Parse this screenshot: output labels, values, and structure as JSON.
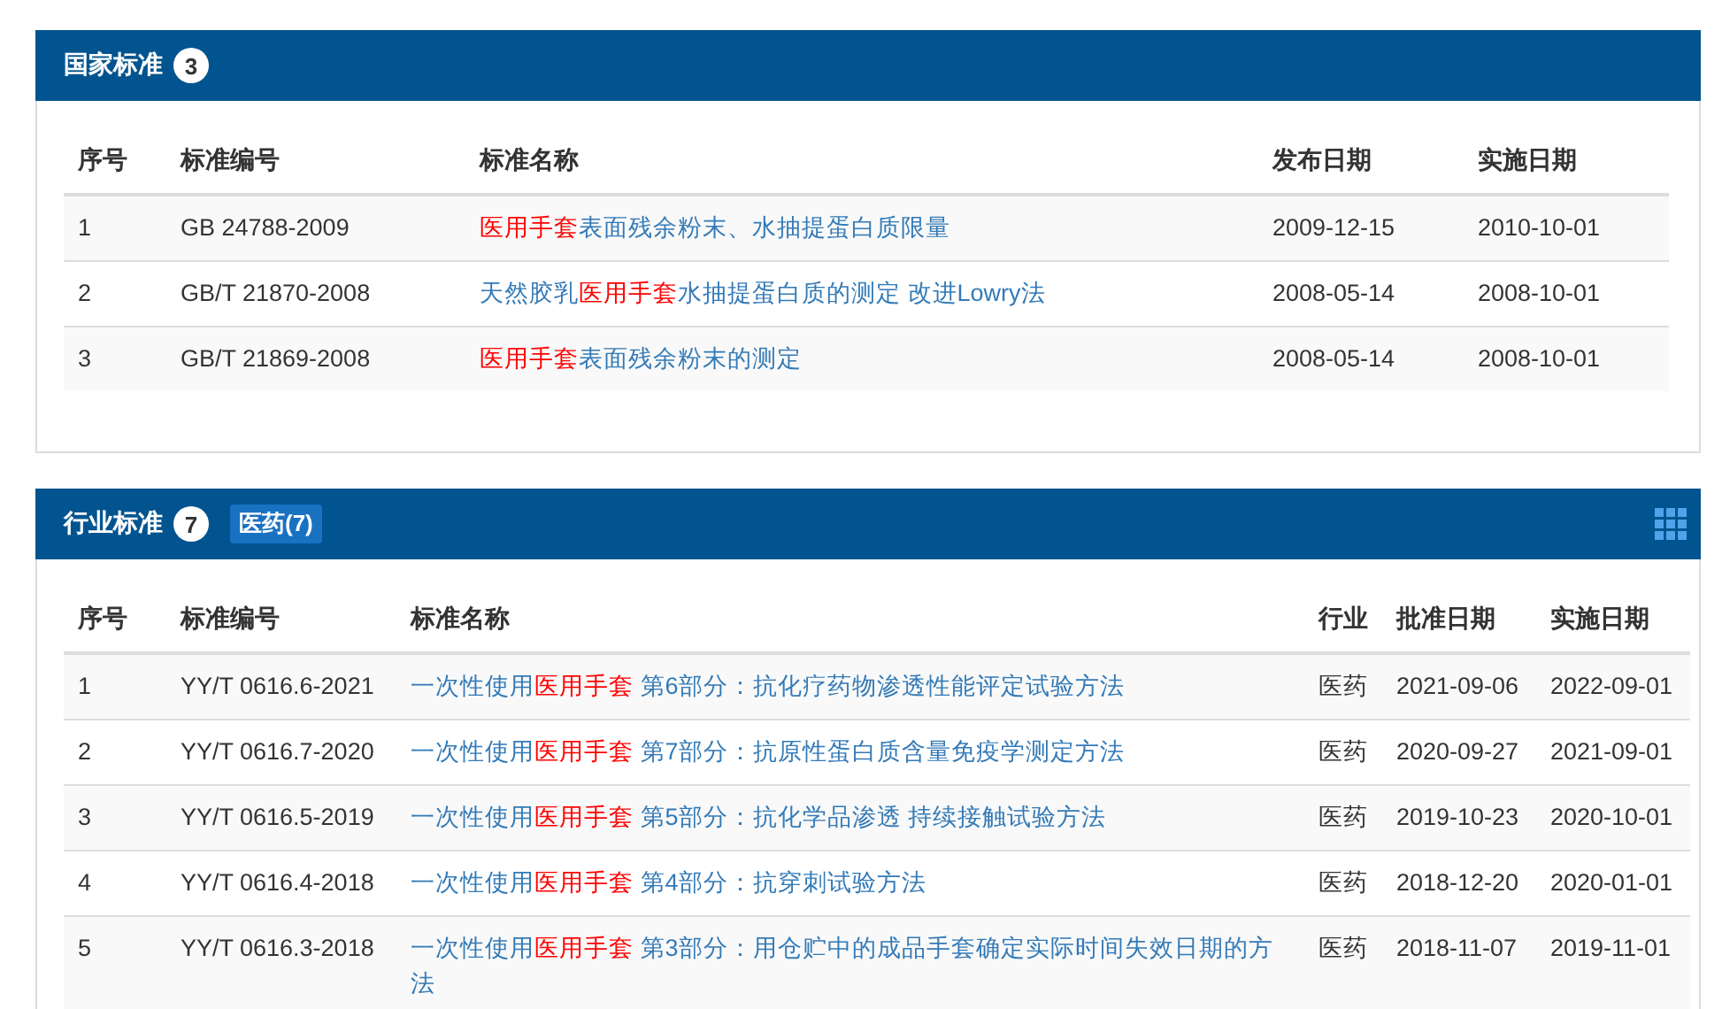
{
  "panels": [
    {
      "title": "国家标准",
      "count": "3",
      "grid_icon": false,
      "columns": [
        {
          "label": "序号",
          "kind": "index"
        },
        {
          "label": "标准编号",
          "kind": "code"
        },
        {
          "label": "标准名称",
          "kind": "name"
        },
        {
          "label": "发布日期",
          "kind": "date"
        },
        {
          "label": "实施日期",
          "kind": "date"
        }
      ],
      "rows": [
        {
          "cells": [
            "1",
            "GB 24788-2009",
            [
              {
                "text": "医用手套",
                "highlight": true
              },
              {
                "text": "表面残余粉末、水抽提蛋白质限量",
                "highlight": false
              }
            ],
            "2009-12-15",
            "2010-10-01"
          ]
        },
        {
          "cells": [
            "2",
            "GB/T 21870-2008",
            [
              {
                "text": "天然胶乳",
                "highlight": false
              },
              {
                "text": "医用手套",
                "highlight": true
              },
              {
                "text": "水抽提蛋白质的测定 改进Lowry法",
                "highlight": false
              }
            ],
            "2008-05-14",
            "2008-10-01"
          ]
        },
        {
          "cells": [
            "3",
            "GB/T 21869-2008",
            [
              {
                "text": "医用手套",
                "highlight": true
              },
              {
                "text": "表面残余粉末的测定",
                "highlight": false
              }
            ],
            "2008-05-14",
            "2008-10-01"
          ]
        }
      ]
    },
    {
      "title": "行业标准",
      "count": "7",
      "tags": [
        "医药(7)"
      ],
      "grid_icon": true,
      "columns": [
        {
          "label": "序号",
          "kind": "index"
        },
        {
          "label": "标准编号",
          "kind": "code2"
        },
        {
          "label": "标准名称",
          "kind": "name2"
        },
        {
          "label": "行业",
          "kind": "industry"
        },
        {
          "label": "批准日期",
          "kind": "date2"
        },
        {
          "label": "实施日期",
          "kind": "date2"
        }
      ],
      "rows": [
        {
          "cells": [
            "1",
            "YY/T 0616.6-2021",
            [
              {
                "text": "一次性使用",
                "highlight": false
              },
              {
                "text": "医用手套",
                "highlight": true
              },
              {
                "text": " 第6部分：抗化疗药物渗透性能评定试验方法",
                "highlight": false
              }
            ],
            "医药",
            "2021-09-06",
            "2022-09-01"
          ]
        },
        {
          "cells": [
            "2",
            "YY/T 0616.7-2020",
            [
              {
                "text": "一次性使用",
                "highlight": false
              },
              {
                "text": "医用手套",
                "highlight": true
              },
              {
                "text": " 第7部分：抗原性蛋白质含量免疫学测定方法",
                "highlight": false
              }
            ],
            "医药",
            "2020-09-27",
            "2021-09-01"
          ]
        },
        {
          "cells": [
            "3",
            "YY/T 0616.5-2019",
            [
              {
                "text": "一次性使用",
                "highlight": false
              },
              {
                "text": "医用手套",
                "highlight": true
              },
              {
                "text": " 第5部分：抗化学品渗透 持续接触试验方法",
                "highlight": false
              }
            ],
            "医药",
            "2019-10-23",
            "2020-10-01"
          ]
        },
        {
          "cells": [
            "4",
            "YY/T 0616.4-2018",
            [
              {
                "text": "一次性使用",
                "highlight": false
              },
              {
                "text": "医用手套",
                "highlight": true
              },
              {
                "text": " 第4部分：抗穿刺试验方法",
                "highlight": false
              }
            ],
            "医药",
            "2018-12-20",
            "2020-01-01"
          ]
        },
        {
          "cells": [
            "5",
            "YY/T 0616.3-2018",
            [
              {
                "text": "一次性使用",
                "highlight": false
              },
              {
                "text": "医用手套",
                "highlight": true
              },
              {
                "text": " 第3部分：用仓贮中的成品手套确定实际时间失效日期的方法",
                "highlight": false
              }
            ],
            "医药",
            "2018-11-07",
            "2019-11-01"
          ]
        }
      ]
    }
  ]
}
